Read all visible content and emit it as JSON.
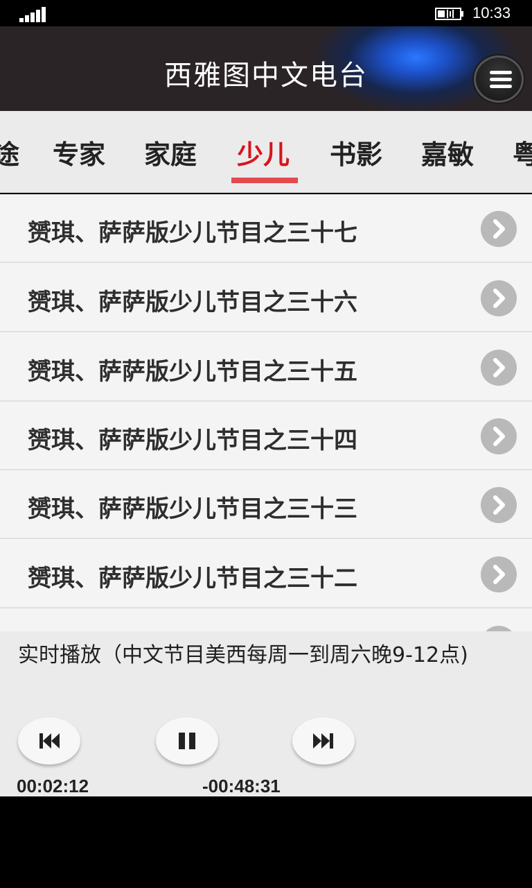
{
  "status_bar": {
    "time": "10:33"
  },
  "header": {
    "title": "西雅图中文电台"
  },
  "tabs": [
    {
      "label": "途",
      "active": false
    },
    {
      "label": "专家",
      "active": false
    },
    {
      "label": "家庭",
      "active": false
    },
    {
      "label": "少儿",
      "active": true
    },
    {
      "label": "书影",
      "active": false
    },
    {
      "label": "嘉敏",
      "active": false
    },
    {
      "label": "粤",
      "active": false
    }
  ],
  "list": {
    "items": [
      {
        "title": "赟琪、萨萨版少儿节目之三十七"
      },
      {
        "title": "赟琪、萨萨版少儿节目之三十六"
      },
      {
        "title": "赟琪、萨萨版少儿节目之三十五"
      },
      {
        "title": "赟琪、萨萨版少儿节目之三十四"
      },
      {
        "title": "赟琪、萨萨版少儿节目之三十三"
      },
      {
        "title": "赟琪、萨萨版少儿节目之三十二"
      }
    ]
  },
  "player": {
    "now_playing": "实时播放（中文节目美西每周一到周六晚9-12点)",
    "elapsed": "00:02:12",
    "remaining": "-00:48:31"
  },
  "colors": {
    "accent": "#d8141c",
    "underline": "#e24a4f",
    "header_glow": "#2a78ff"
  },
  "icons": [
    "signal-icon",
    "battery-icon",
    "menu-icon",
    "chevron-right-icon",
    "previous-icon",
    "pause-icon",
    "next-icon"
  ]
}
